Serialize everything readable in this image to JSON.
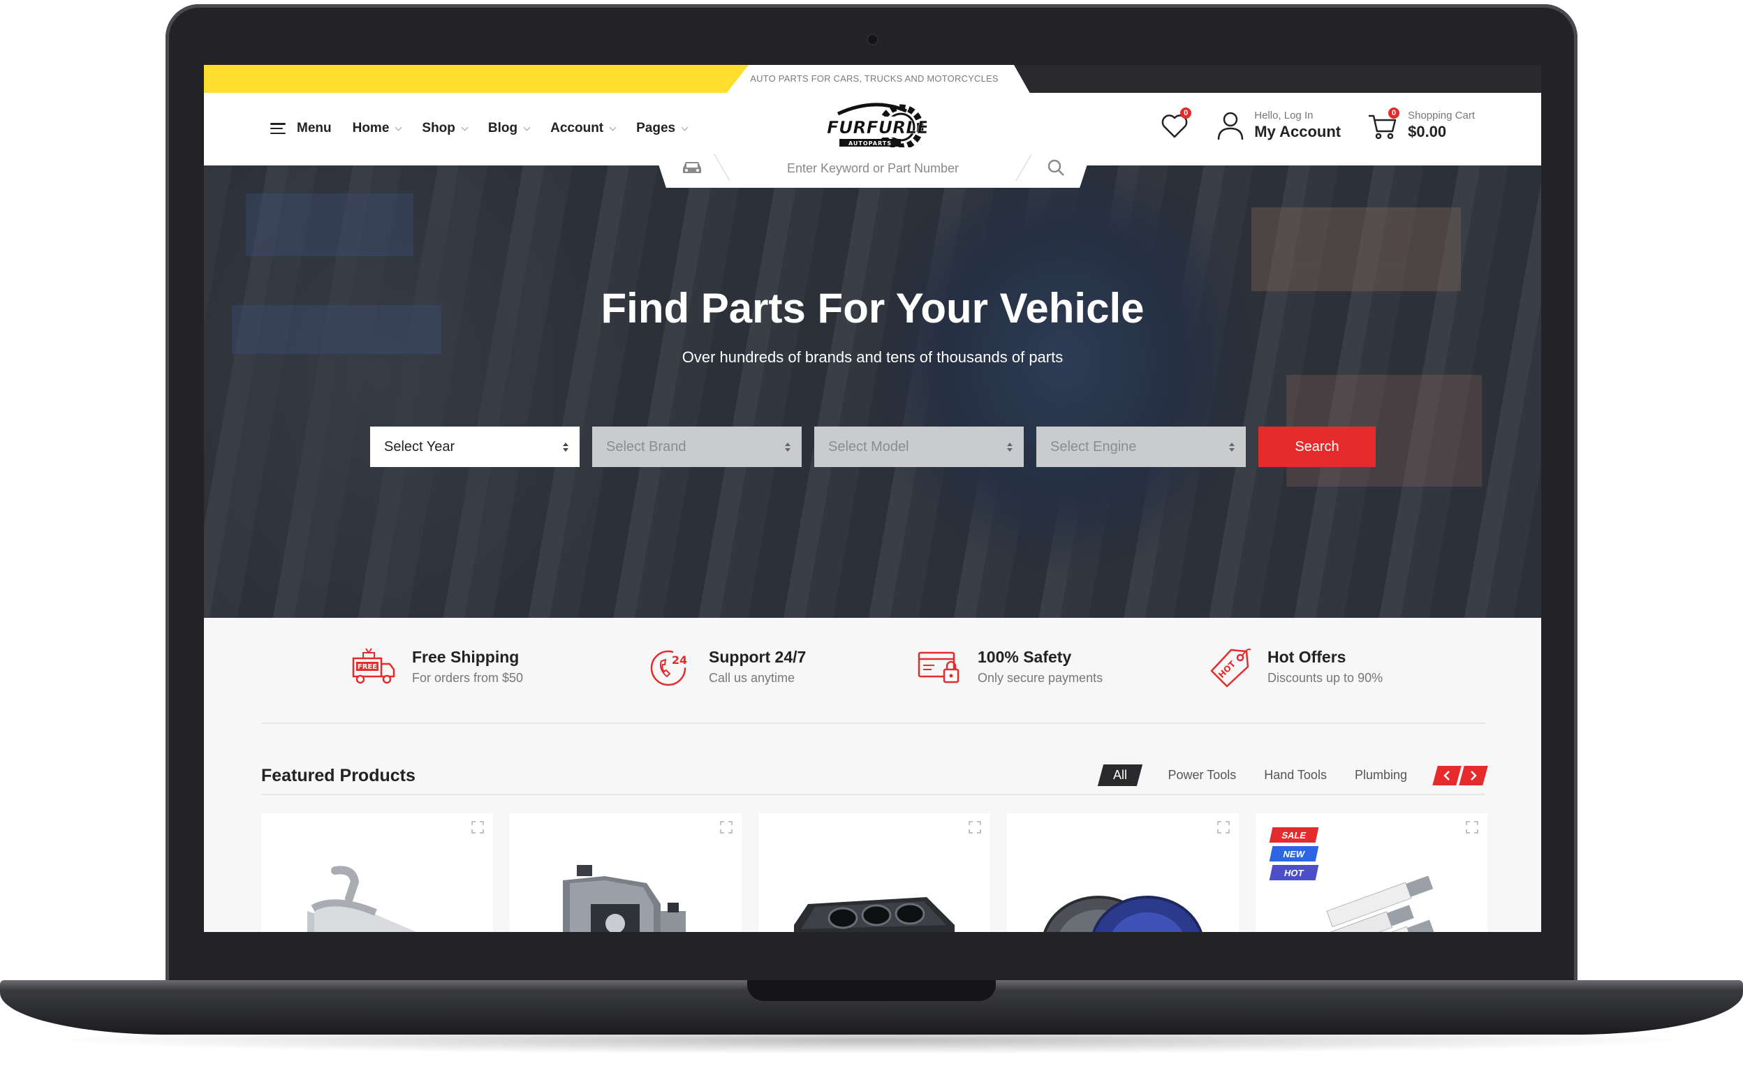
{
  "topbar": {
    "tagline": "AUTO PARTS FOR CARS, TRUCKS AND MOTORCYCLES"
  },
  "logo": {
    "text": "FURFURLE",
    "sub": "AUTOPARTS"
  },
  "nav": {
    "menu": "Menu",
    "items": [
      {
        "label": "Home"
      },
      {
        "label": "Shop"
      },
      {
        "label": "Blog"
      },
      {
        "label": "Account"
      },
      {
        "label": "Pages"
      }
    ]
  },
  "header": {
    "wishlist_count": "0",
    "account_small": "Hello, Log In",
    "account_big": "My Account",
    "cart_small": "Shopping Cart",
    "cart_total": "$0.00",
    "cart_count": "0"
  },
  "search": {
    "placeholder": "Enter Keyword or Part Number"
  },
  "hero": {
    "title": "Find Parts For Your Vehicle",
    "subtitle": "Over hundreds of brands and tens of thousands of parts",
    "year": "Select Year",
    "brand": "Select Brand",
    "model": "Select Model",
    "engine": "Select Engine",
    "button": "Search"
  },
  "features": [
    {
      "title": "Free Shipping",
      "desc": "For orders from $50",
      "icon": "free-truck-icon",
      "icon_text": "FREE"
    },
    {
      "title": "Support 24/7",
      "desc": "Call us anytime",
      "icon": "support-24-icon",
      "icon_text": "24"
    },
    {
      "title": "100% Safety",
      "desc": "Only secure payments",
      "icon": "secure-card-icon"
    },
    {
      "title": "Hot Offers",
      "desc": "Discounts up to 90%",
      "icon": "hot-tag-icon",
      "icon_text": "HOT"
    }
  ],
  "featured": {
    "title": "Featured Products",
    "tabs": [
      "All",
      "Power Tools",
      "Hand Tools",
      "Plumbing"
    ],
    "badges": [
      "SALE",
      "NEW",
      "HOT"
    ]
  },
  "colors": {
    "accent": "#e52b2b",
    "yellow": "#ffde2e",
    "dark": "#2a2a2d"
  }
}
